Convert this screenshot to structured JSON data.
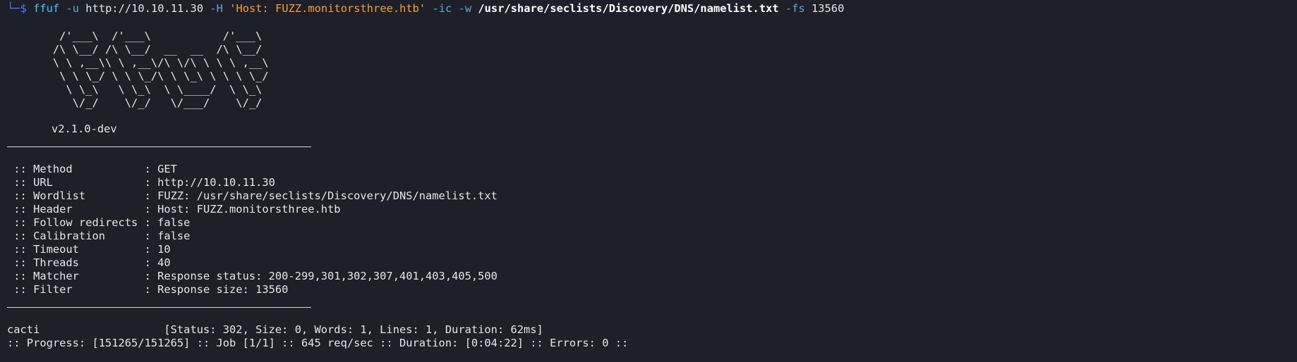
{
  "terminal": {
    "prompt": {
      "corner": "└─",
      "dollar": "$"
    },
    "command": {
      "name": "ffuf",
      "flag_u": "-u",
      "url": "http://10.10.11.30",
      "flag_h": "-H",
      "header_value": "'Host: FUZZ.monitorsthree.htb'",
      "flag_ic": "-ic",
      "flag_w": "-w",
      "wordlist": "/usr/share/seclists/Discovery/DNS/namelist.txt",
      "flag_fs": "-fs",
      "fs_value": "13560"
    },
    "banner": {
      "lines": [
        "        /'___\\  /'___\\           /'___\\",
        "       /\\ \\__/ /\\ \\__/  __  __  /\\ \\__/",
        "       \\ \\ ,__\\\\ \\ ,__\\/\\ \\/\\ \\ \\ \\ ,__\\",
        "        \\ \\ \\_/ \\ \\ \\_/\\ \\ \\_\\ \\ \\ \\ \\_/",
        "         \\ \\_\\   \\ \\_\\  \\ \\____/  \\ \\_\\",
        "          \\/_/    \\/_/   \\/___/    \\/_/"
      ],
      "version": "v2.1.0-dev"
    },
    "config": [
      " :: Method           : GET",
      " :: URL              : http://10.10.11.30",
      " :: Wordlist         : FUZZ: /usr/share/seclists/Discovery/DNS/namelist.txt",
      " :: Header           : Host: FUZZ.monitorsthree.htb",
      " :: Follow redirects : false",
      " :: Calibration      : false",
      " :: Timeout          : 10",
      " :: Threads          : 40",
      " :: Matcher          : Response status: 200-299,301,302,307,401,403,405,500",
      " :: Filter           : Response size: 13560"
    ],
    "result": "cacti                   [Status: 302, Size: 0, Words: 1, Lines: 1, Duration: 62ms]",
    "progress": ":: Progress: [151265/151265] :: Job [1/1] :: 645 req/sec :: Duration: [0:04:22] :: Errors: 0 ::"
  }
}
